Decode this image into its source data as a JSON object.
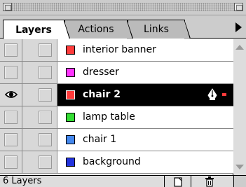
{
  "tabs": [
    {
      "label": "Layers",
      "active": true
    },
    {
      "label": "Actions",
      "active": false
    },
    {
      "label": "Links",
      "active": false
    }
  ],
  "layers": [
    {
      "name": "interior banner",
      "color": "#ff3b3b",
      "visible": false,
      "selected": false
    },
    {
      "name": "dresser",
      "color": "#ff33ff",
      "visible": false,
      "selected": false
    },
    {
      "name": "chair 2",
      "color": "#ff3b3b",
      "visible": true,
      "selected": true
    },
    {
      "name": "lamp table",
      "color": "#33dd33",
      "visible": false,
      "selected": false
    },
    {
      "name": "chair 1",
      "color": "#4488ee",
      "visible": false,
      "selected": false
    },
    {
      "name": "background",
      "color": "#2233dd",
      "visible": false,
      "selected": false
    }
  ],
  "footer": {
    "count_label": "6 Layers"
  },
  "icons": {
    "visibility": "eye-icon",
    "editing": "pen-nib-icon",
    "new_layer": "new-layer-icon",
    "delete": "trash-icon",
    "menu": "panel-menu-arrow-icon"
  }
}
